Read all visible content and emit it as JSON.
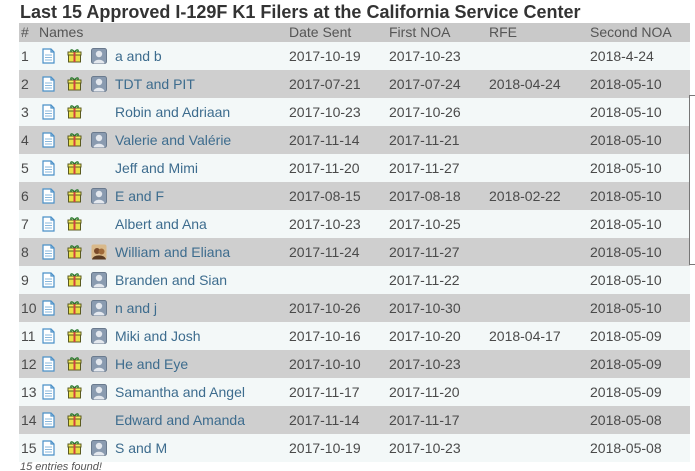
{
  "title": "Last 15 Approved I-129F K1 Filers at the California Service Center",
  "headers": {
    "num": "#",
    "names": "Names",
    "date_sent": "Date Sent",
    "first_noa": "First NOA",
    "rfe": "RFE",
    "second_noa": "Second NOA"
  },
  "icons": {
    "doc": "document-icon",
    "gift": "gift-icon",
    "avatar": "avatar-icon"
  },
  "colors": {
    "link": "#3d6c8e",
    "row_odd": "#f3f8f8",
    "row_even": "#cfcfcf",
    "header": "#c9c9c9"
  },
  "rows": [
    {
      "num": "1",
      "name": "a and b",
      "avatar": "generic",
      "date_sent": "2017-10-19",
      "first_noa": "2017-10-23",
      "rfe": "",
      "second_noa": "2018-4-24"
    },
    {
      "num": "2",
      "name": "TDT and PIT",
      "avatar": "generic",
      "date_sent": "2017-07-21",
      "first_noa": "2017-07-24",
      "rfe": "2018-04-24",
      "second_noa": "2018-05-10"
    },
    {
      "num": "3",
      "name": "Robin and Adriaan",
      "avatar": "none",
      "date_sent": "2017-10-23",
      "first_noa": "2017-10-26",
      "rfe": "",
      "second_noa": "2018-05-10"
    },
    {
      "num": "4",
      "name": "Valerie and Valérie",
      "avatar": "generic",
      "date_sent": "2017-11-14",
      "first_noa": "2017-11-21",
      "rfe": "",
      "second_noa": "2018-05-10"
    },
    {
      "num": "5",
      "name": "Jeff and Mimi",
      "avatar": "none",
      "date_sent": "2017-11-20",
      "first_noa": "2017-11-27",
      "rfe": "",
      "second_noa": "2018-05-10"
    },
    {
      "num": "6",
      "name": "E and F",
      "avatar": "generic",
      "date_sent": "2017-08-15",
      "first_noa": "2017-08-18",
      "rfe": "2018-02-22",
      "second_noa": "2018-05-10"
    },
    {
      "num": "7",
      "name": "Albert and Ana",
      "avatar": "none",
      "date_sent": "2017-10-23",
      "first_noa": "2017-10-25",
      "rfe": "",
      "second_noa": "2018-05-10"
    },
    {
      "num": "8",
      "name": "William and Eliana",
      "avatar": "photo",
      "date_sent": "2017-11-24",
      "first_noa": "2017-11-27",
      "rfe": "",
      "second_noa": "2018-05-10"
    },
    {
      "num": "9",
      "name": "Branden and Sian",
      "avatar": "generic",
      "date_sent": "",
      "first_noa": "2017-11-22",
      "rfe": "",
      "second_noa": "2018-05-10"
    },
    {
      "num": "10",
      "name": "n and j",
      "avatar": "generic",
      "date_sent": "2017-10-26",
      "first_noa": "2017-10-30",
      "rfe": "",
      "second_noa": "2018-05-10"
    },
    {
      "num": "11",
      "name": "Miki and Josh",
      "avatar": "generic",
      "date_sent": "2017-10-16",
      "first_noa": "2017-10-20",
      "rfe": "2018-04-17",
      "second_noa": "2018-05-09"
    },
    {
      "num": "12",
      "name": "He and Eye",
      "avatar": "generic",
      "date_sent": "2017-10-10",
      "first_noa": "2017-10-23",
      "rfe": "",
      "second_noa": "2018-05-09"
    },
    {
      "num": "13",
      "name": "Samantha and Angel",
      "avatar": "generic",
      "date_sent": "2017-11-17",
      "first_noa": "2017-11-20",
      "rfe": "",
      "second_noa": "2018-05-09"
    },
    {
      "num": "14",
      "name": "Edward and Amanda",
      "avatar": "none",
      "date_sent": "2017-11-14",
      "first_noa": "2017-11-17",
      "rfe": "",
      "second_noa": "2018-05-08"
    },
    {
      "num": "15",
      "name": "S and M",
      "avatar": "generic",
      "date_sent": "2017-10-19",
      "first_noa": "2017-10-23",
      "rfe": "",
      "second_noa": "2018-05-08"
    }
  ],
  "footer": "15 entries found!"
}
